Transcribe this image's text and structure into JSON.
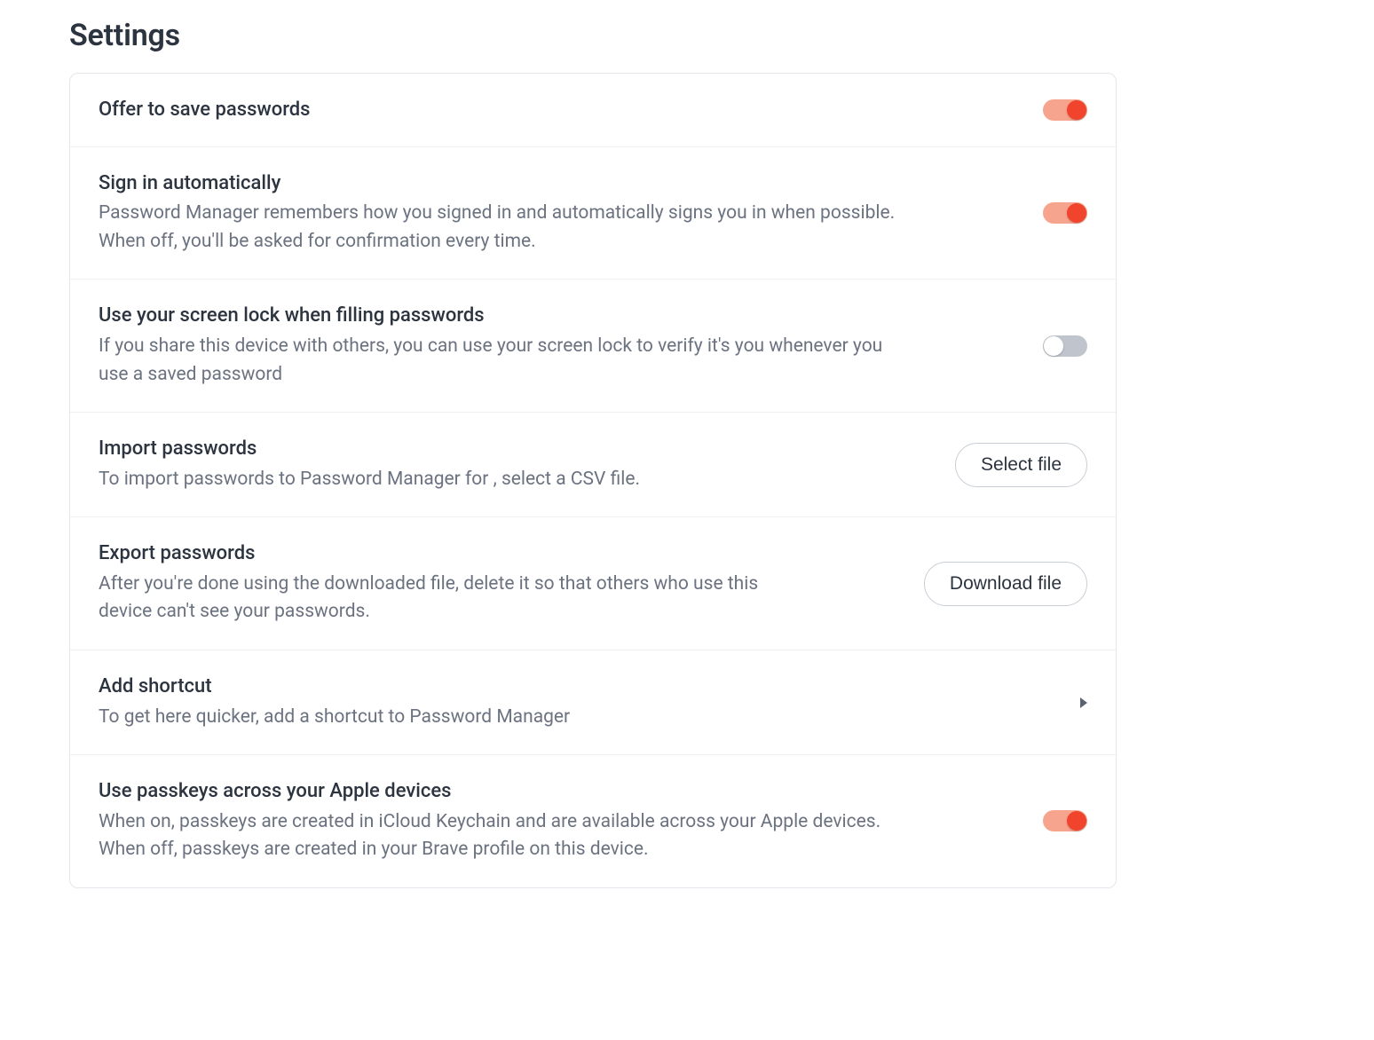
{
  "page_title": "Settings",
  "rows": {
    "offer_save": {
      "title": "Offer to save passwords",
      "on": true
    },
    "sign_in_auto": {
      "title": "Sign in automatically",
      "desc": "Password Manager remembers how you signed in and automatically signs you in when possible. When off, you'll be asked for confirmation every time.",
      "on": true
    },
    "screen_lock": {
      "title": "Use your screen lock when filling passwords",
      "desc": "If you share this device with others, you can use your screen lock to verify it's you whenever you use a saved password",
      "on": false
    },
    "import": {
      "title": "Import passwords",
      "desc": "To import passwords to Password Manager for , select a CSV file.",
      "button": "Select file"
    },
    "export": {
      "title": "Export passwords",
      "desc": "After you're done using the downloaded file, delete it so that others who use this device can't see your passwords.",
      "button": "Download file"
    },
    "shortcut": {
      "title": "Add shortcut",
      "desc": "To get here quicker, add a shortcut to Password Manager"
    },
    "passkeys": {
      "title": "Use passkeys across your Apple devices",
      "desc": "When on, passkeys are created in iCloud Keychain and are available across your Apple devices. When off, passkeys are created in your Brave profile on this device.",
      "on": true
    }
  }
}
